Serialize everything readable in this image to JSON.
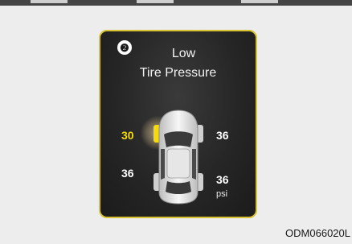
{
  "display": {
    "callout_number": "❷",
    "warning_line1": "Low",
    "warning_line2": "Tire Pressure"
  },
  "tires": {
    "front_left": "30",
    "front_right": "36",
    "rear_left": "36",
    "rear_right": "36",
    "unit": "psi",
    "low_tire": "front_left"
  },
  "figure_code": "ODM066020L",
  "colors": {
    "frame_border": "#d8c232",
    "alert_value": "#f4d90b",
    "screen_background": "#262626",
    "page_background": "#ededed"
  },
  "icons": {
    "vehicle": "car-top-view-icon",
    "low_tire_indicator": "low-tire-glow-icon"
  }
}
